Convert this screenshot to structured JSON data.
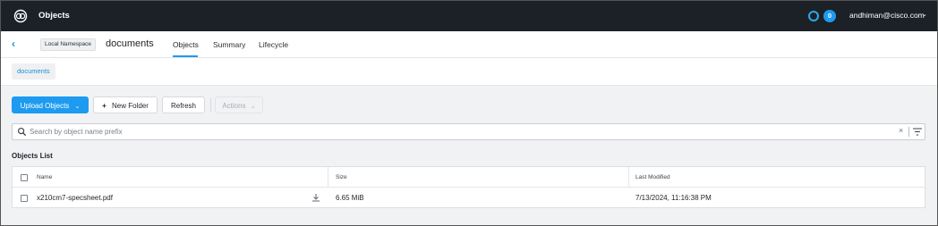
{
  "topbar": {
    "app_title": "Objects",
    "notification_count": "0",
    "user_email": "andhiman@cisco.com",
    "user_caret": "⌄"
  },
  "header": {
    "back_glyph": "‹",
    "namespace_badge": "Local Namespace",
    "bucket_name": "documents",
    "tabs": [
      {
        "label": "Objects",
        "active": true
      },
      {
        "label": "Summary",
        "active": false
      },
      {
        "label": "Lifecycle",
        "active": false
      }
    ]
  },
  "breadcrumb": {
    "item": "documents"
  },
  "toolbar": {
    "upload_label": "Upload Objects",
    "upload_caret": "⌄",
    "new_folder_glyph": "+",
    "new_folder_label": "New Folder",
    "refresh_label": "Refresh",
    "actions_label": "Actions",
    "actions_caret": "⌄"
  },
  "search": {
    "placeholder": "Search by object name prefix",
    "value": "",
    "clear_glyph": "×"
  },
  "list": {
    "title": "Objects List",
    "columns": [
      "Name",
      "Size",
      "Last Modified"
    ],
    "rows": [
      {
        "name": "x210cm7-specsheet.pdf",
        "size": "6.65 MiB",
        "modified": "7/13/2024, 11:16:38 PM"
      }
    ]
  },
  "colors": {
    "topbar_bg": "#1c2128",
    "accent": "#1d9bf0",
    "page_bg": "#f1f2f4"
  },
  "icons": [
    "logo-icon",
    "ring-icon",
    "back-icon",
    "search-icon",
    "clear-icon",
    "filter-icon",
    "download-icon"
  ]
}
